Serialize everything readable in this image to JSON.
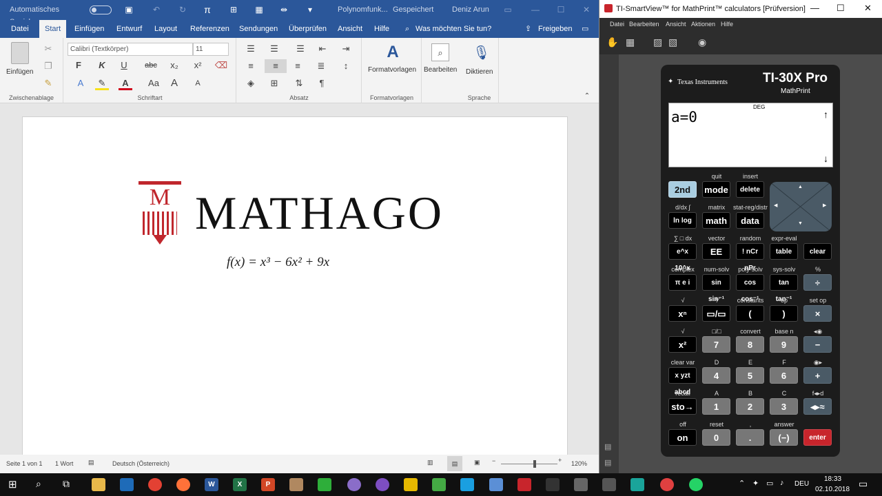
{
  "word": {
    "qat": {
      "autosave": "Automatisches Speichern",
      "title": "Polynomfunk...",
      "saved": "Gespeichert",
      "user": "Deniz Arun",
      "pi": "π"
    },
    "tabs": [
      "Datei",
      "Start",
      "Einfügen",
      "Entwurf",
      "Layout",
      "Referenzen",
      "Sendungen",
      "Überprüfen",
      "Ansicht",
      "Hilfe"
    ],
    "search": "Was möchten Sie tun?",
    "share": "Freigeben",
    "ribbon": {
      "paste": "Einfügen",
      "clipboard": "Zwischenablage",
      "font_name": "Calibri (Textkörper)",
      "font_size": "11",
      "font_group": "Schriftart",
      "para_group": "Absatz",
      "styles_btn": "Formatvorlagen",
      "styles_group": "Formatvorlagen",
      "edit_btn": "Bearbeiten",
      "dictate_btn": "Diktieren",
      "speech_group": "Sprache",
      "bold": "F",
      "italic": "K",
      "underline": "U",
      "strike": "abc",
      "fontcolor": "A",
      "case": "Aa",
      "grow": "A",
      "shrink": "A",
      "pilcrow": "¶"
    },
    "doc": {
      "logo": "MATHAGO",
      "logo_letter": "M",
      "formula": "f(x) = x³ − 6x² + 9x"
    },
    "status": {
      "page": "Seite 1 von 1",
      "words": "1 Wort",
      "lang": "Deutsch (Österreich)",
      "zoom": "120%",
      "zoom_level": 0.6
    }
  },
  "ti": {
    "title": "TI-SmartView™ for MathPrint™ calculators [Prüfversion]",
    "menu": [
      "Datei",
      "Bearbeiten",
      "Ansicht",
      "Aktionen",
      "Hilfe"
    ],
    "brand": "Texas Instruments",
    "model": "TI-30X Pro",
    "model_sub": "MathPrint",
    "screen": {
      "mode": "DEG",
      "line": "a=0",
      "up": "↑",
      "down": "↓"
    },
    "keys": [
      {
        "label": "2nd",
        "style": "lb"
      },
      {
        "label": "mode",
        "style": ""
      },
      {
        "label": "delete",
        "style": ""
      },
      {
        "label": "ln log",
        "style": ""
      },
      {
        "label": "math",
        "style": ""
      },
      {
        "label": "data",
        "style": ""
      },
      {
        "label": "e^x 10^x",
        "style": ""
      },
      {
        "label": "EE",
        "style": ""
      },
      {
        "label": "! nCr nPr",
        "style": ""
      },
      {
        "label": "table",
        "style": ""
      },
      {
        "label": "clear",
        "style": ""
      },
      {
        "label": "π e i",
        "style": ""
      },
      {
        "label": "sin sin⁻¹",
        "style": ""
      },
      {
        "label": "cos cos⁻¹",
        "style": ""
      },
      {
        "label": "tan tan⁻¹",
        "style": ""
      },
      {
        "label": "÷",
        "style": "b"
      },
      {
        "label": "xⁿ",
        "style": ""
      },
      {
        "label": "▭/▭",
        "style": ""
      },
      {
        "label": "(",
        "style": ""
      },
      {
        "label": ")",
        "style": ""
      },
      {
        "label": "×",
        "style": "b"
      },
      {
        "label": "x²",
        "style": ""
      },
      {
        "label": "7",
        "style": "g"
      },
      {
        "label": "8",
        "style": "g"
      },
      {
        "label": "9",
        "style": "g"
      },
      {
        "label": "−",
        "style": "b"
      },
      {
        "label": "x yzt abcd",
        "style": ""
      },
      {
        "label": "4",
        "style": "g"
      },
      {
        "label": "5",
        "style": "g"
      },
      {
        "label": "6",
        "style": "g"
      },
      {
        "label": "+",
        "style": "b"
      },
      {
        "label": "sto→",
        "style": ""
      },
      {
        "label": "1",
        "style": "g"
      },
      {
        "label": "2",
        "style": "g"
      },
      {
        "label": "3",
        "style": "g"
      },
      {
        "label": "◂▸≈",
        "style": "b"
      },
      {
        "label": "on",
        "style": ""
      },
      {
        "label": "0",
        "style": "g"
      },
      {
        "label": ".",
        "style": "g"
      },
      {
        "label": "(−)",
        "style": "g"
      },
      {
        "label": "enter",
        "style": "r"
      }
    ],
    "second": {
      "r1": [
        "quit",
        "insert"
      ],
      "r2": [
        "d/dx ∫",
        "matrix",
        "stat-reg/distr"
      ],
      "r3": [
        "∑ □ dx",
        "vector",
        "random",
        "expr-eval"
      ],
      "r4": [
        "complex",
        "num-solv",
        "poly-solv",
        "sys-solv",
        "%"
      ],
      "r5": [
        "√",
        "⅟",
        "constants",
        "op",
        "set op"
      ],
      "r6": [
        "√",
        "□/□",
        "convert",
        "base n",
        "◂◉"
      ],
      "r7": [
        "clear var",
        "D",
        "E",
        "F",
        "◉▸"
      ],
      "r8": [
        "recall",
        "A",
        "B",
        "C",
        "f◂▸d"
      ],
      "r9": [
        "off",
        "reset",
        ",",
        "answer"
      ]
    }
  },
  "taskbar": {
    "lang": "DEU",
    "time": "18:33",
    "date": "02.10.2018"
  },
  "colors": {
    "word_blue": "#2b579a",
    "logo_red": "#c0272d",
    "ti_enter": "#c8252c",
    "ti_second": "#a9cde0"
  }
}
